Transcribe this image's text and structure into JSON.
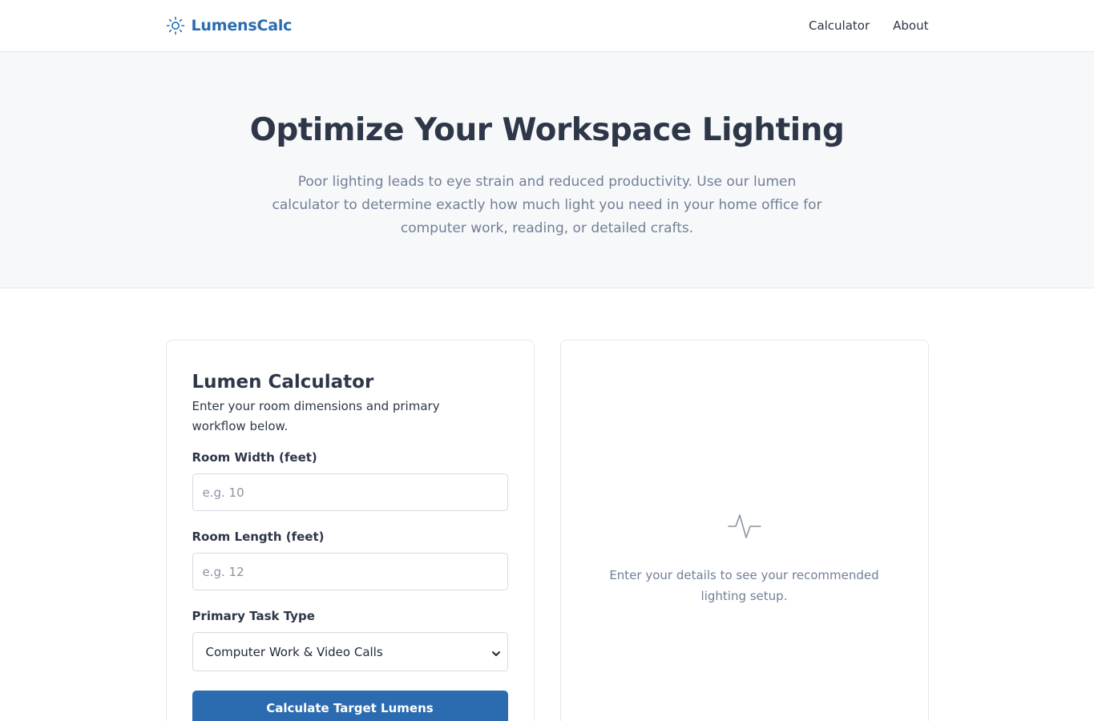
{
  "header": {
    "brand": "LumensCalc",
    "brand_icon": "sun-icon",
    "nav": [
      "Calculator",
      "About"
    ]
  },
  "hero": {
    "title": "Optimize Your Workspace Lighting",
    "subtitle": "Poor lighting leads to eye strain and reduced productivity. Use our lumen calculator to determine exactly how much light you need in your home office for computer work, reading, or detailed crafts."
  },
  "calculator": {
    "title": "Lumen Calculator",
    "subtitle": "Enter your room dimensions and primary workflow below.",
    "width_label": "Room Width (feet)",
    "width_placeholder": "e.g. 10",
    "width_value": "",
    "length_label": "Room Length (feet)",
    "length_placeholder": "e.g. 12",
    "length_value": "",
    "task_label": "Primary Task Type",
    "task_selected": "Computer Work & Video Calls",
    "submit_label": "Calculate Target Lumens"
  },
  "result": {
    "icon": "pulse-icon",
    "empty_message": "Enter your details to see your recommended lighting setup."
  },
  "colors": {
    "brand": "#2b6cb0",
    "heading": "#2d3748",
    "muted": "#718096",
    "hero_bg": "#f7f8fa",
    "border": "#e2e8f0"
  }
}
